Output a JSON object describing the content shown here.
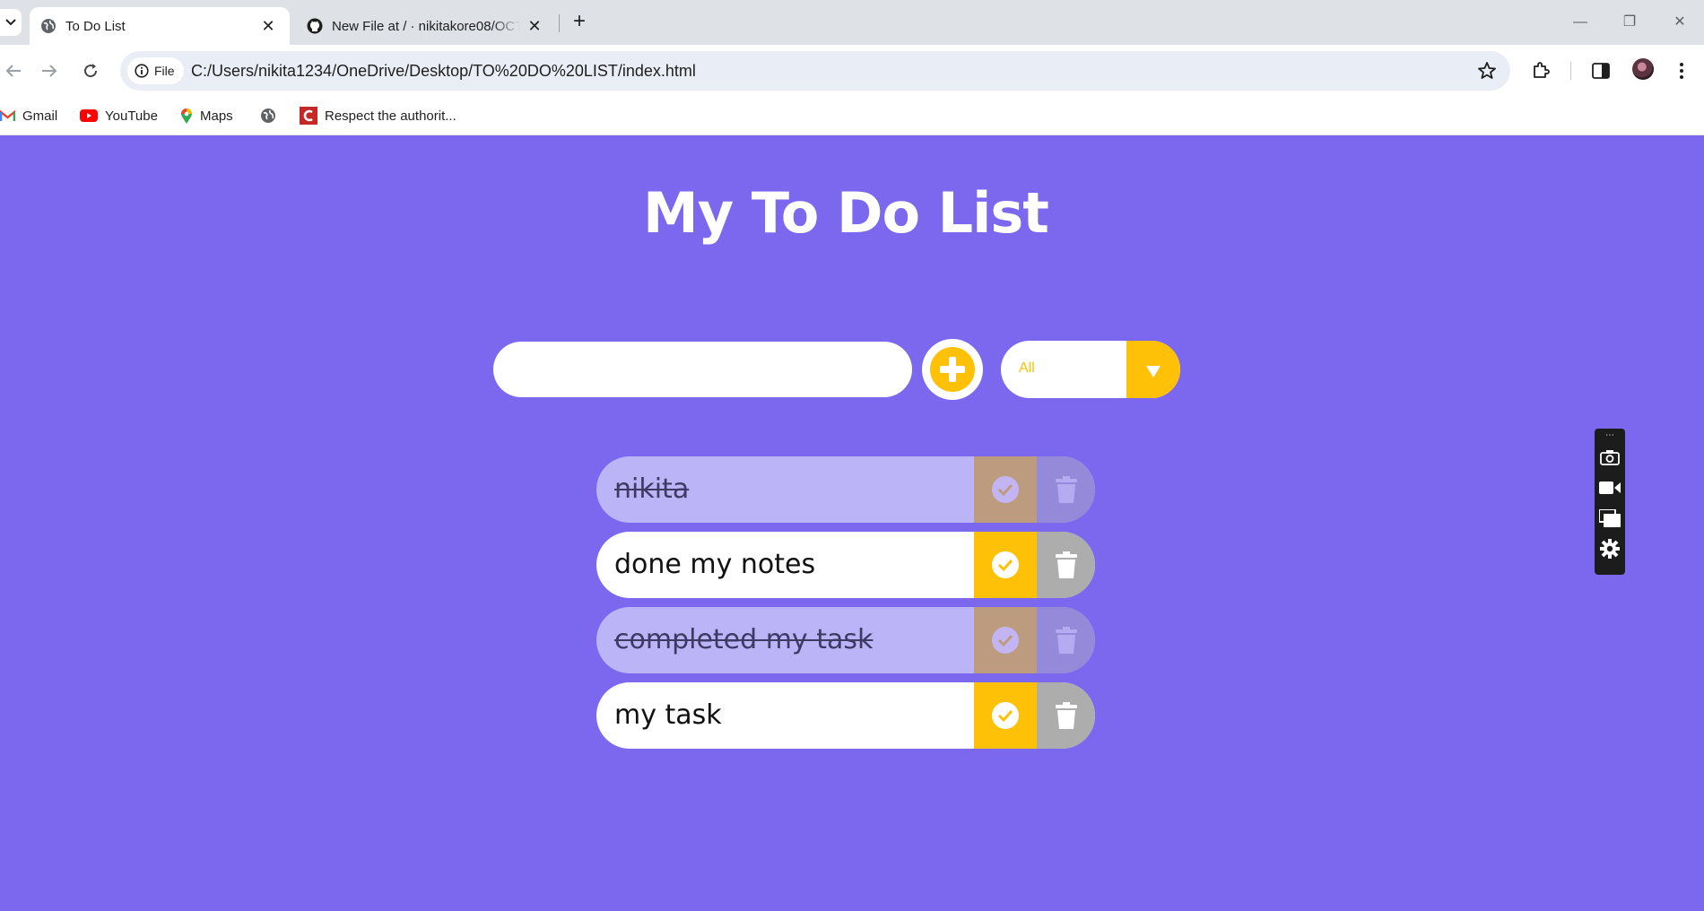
{
  "browser": {
    "tabs": [
      {
        "title": "To Do List",
        "active": true
      },
      {
        "title": "New File at / · nikitakore08/OCT",
        "active": false
      }
    ],
    "address": {
      "chip_label": "File",
      "url": "C:/Users/nikita1234/OneDrive/Desktop/TO%20DO%20LIST/index.html"
    },
    "bookmarks": [
      {
        "label": "Gmail",
        "icon": "gmail-icon"
      },
      {
        "label": "YouTube",
        "icon": "youtube-icon"
      },
      {
        "label": "Maps",
        "icon": "maps-icon"
      },
      {
        "label": "",
        "icon": "globe-icon"
      },
      {
        "label": "Respect the authorit...",
        "icon": "c-logo-icon"
      }
    ]
  },
  "app": {
    "title": "My To Do List",
    "input": {
      "value": "",
      "placeholder": ""
    },
    "filter": {
      "selected": "All"
    },
    "colors": {
      "background": "#7b68ee",
      "accent": "#ffc107",
      "trash": "#adadad",
      "completed_item": "#bbb5f7"
    },
    "todos": [
      {
        "text": "nikita",
        "completed": true
      },
      {
        "text": "done my notes",
        "completed": false
      },
      {
        "text": "completed my task",
        "completed": true
      },
      {
        "text": "my task",
        "completed": false
      }
    ]
  }
}
